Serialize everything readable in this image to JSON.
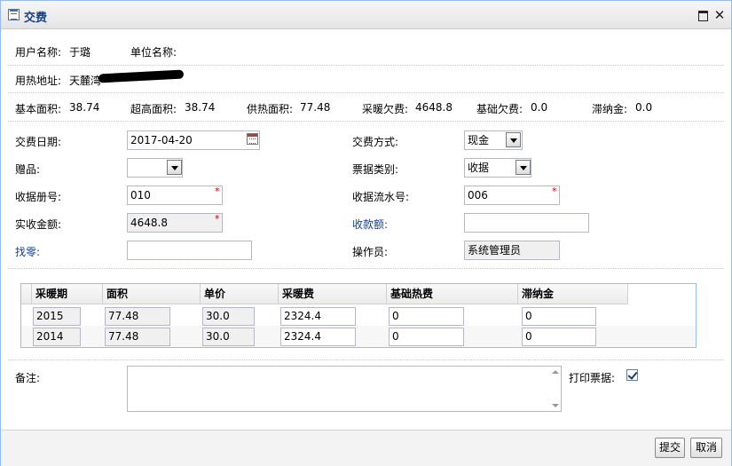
{
  "window": {
    "title": "交费"
  },
  "info": {
    "user_name_label": "用户名称:",
    "user_name_value": "于璐",
    "unit_name_label": "单位名称:",
    "unit_name_value": "",
    "address_label": "用热地址:",
    "address_value": "天麓湾",
    "basic_area_label": "基本面积:",
    "basic_area_value": "38.74",
    "high_area_label": "超高面积:",
    "high_area_value": "38.74",
    "supply_area_label": "供热面积:",
    "supply_area_value": "77.48",
    "heating_arrears_label": "采暖欠费:",
    "heating_arrears_value": "4648.8",
    "basic_arrears_label": "基础欠费:",
    "basic_arrears_value": "0.0",
    "late_fee_label": "滞纳金:",
    "late_fee_value": "0.0"
  },
  "form": {
    "pay_date_label": "交费日期:",
    "pay_date_value": "2017-04-20",
    "pay_method_label": "交费方式:",
    "pay_method_value": "现金",
    "gift_label": "赠品:",
    "gift_value": "",
    "receipt_type_label": "票据类别:",
    "receipt_type_value": "收据",
    "receipt_book_label": "收据册号:",
    "receipt_book_value": "010",
    "receipt_serial_label": "收据流水号:",
    "receipt_serial_value": "006",
    "actual_amount_label": "实收金额:",
    "actual_amount_value": "4648.8",
    "received_amount_label": "收款额:",
    "received_amount_value": "",
    "change_label": "找零:",
    "change_value": "",
    "operator_label": "操作员:",
    "operator_value": "系统管理员",
    "required_mark": "*"
  },
  "grid": {
    "columns": [
      "采暖期",
      "面积",
      "单价",
      "采暖费",
      "基础热费",
      "滞纳金"
    ],
    "rows": [
      [
        "2015",
        "77.48",
        "30.0",
        "2324.4",
        "0",
        "0"
      ],
      [
        "2014",
        "77.48",
        "30.0",
        "2324.4",
        "0",
        "0"
      ]
    ]
  },
  "remarks": {
    "label": "备注:",
    "value": "",
    "print_label": "打印票据:",
    "print_checked": true
  },
  "buttons": {
    "submit": "提交",
    "cancel": "取消"
  }
}
